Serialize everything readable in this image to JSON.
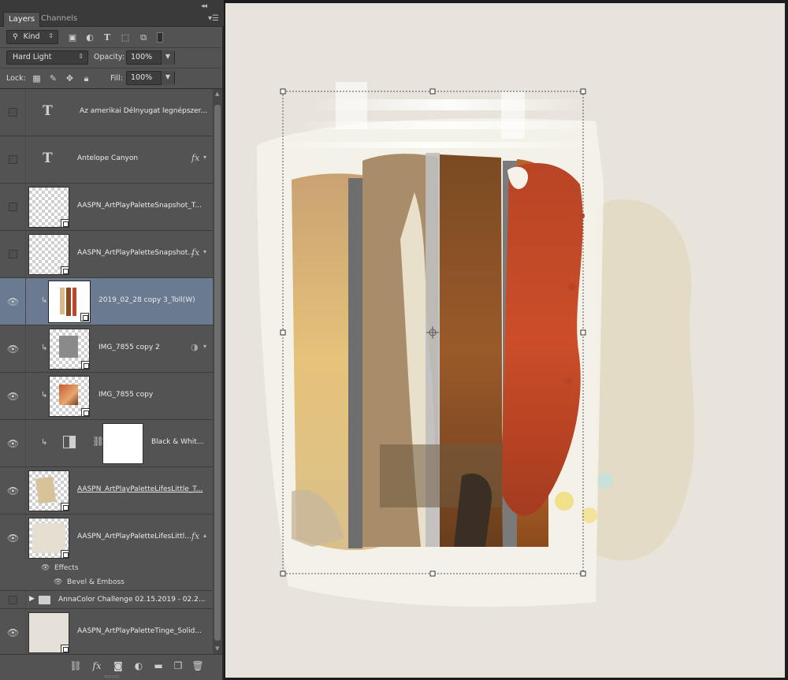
{
  "panel": {
    "collapse_glyph": "◂◂",
    "close_glyph": "✕",
    "menu_glyph": "▾☰",
    "tabs": [
      {
        "label": "Layers"
      },
      {
        "label": "Channels"
      }
    ],
    "filter": {
      "kind_label": "Kind"
    },
    "blend": {
      "mode": "Hard Light",
      "opacity_label": "Opacity:",
      "opacity_value": "100%"
    },
    "lock": {
      "label": "Lock:",
      "fill_label": "Fill:",
      "fill_value": "100%"
    }
  },
  "layers": [
    {
      "name": "Az amerikai Délnyugat legnépszer...",
      "type": "text",
      "visible": false
    },
    {
      "name": "Antelope Canyon",
      "type": "text",
      "visible": false,
      "fx": "fx"
    },
    {
      "name": "AASPN_ArtPlayPaletteSnapshot_T...",
      "type": "image",
      "visible": false
    },
    {
      "name": "AASPN_ArtPlayPaletteSnapshot...",
      "type": "image",
      "visible": false,
      "fx": "fx"
    },
    {
      "name": "2019_02_28 copy 3_Toll(W)",
      "type": "image",
      "visible": true,
      "clipped": true,
      "selected": true
    },
    {
      "name": "IMG_7855 copy 2",
      "type": "image",
      "visible": true,
      "clipped": true
    },
    {
      "name": "IMG_7855 copy",
      "type": "image",
      "visible": true,
      "clipped": true
    },
    {
      "name": "Black & Whit...",
      "type": "adjustment",
      "visible": true,
      "clipped": true
    },
    {
      "name": "AASPN_ArtPlayPaletteLifesLittle_T...",
      "type": "image",
      "visible": true
    },
    {
      "name": "AASPN_ArtPlayPaletteLifesLittl...",
      "type": "image",
      "visible": true,
      "fx": "fx"
    }
  ],
  "effects": {
    "label": "Effects",
    "items": [
      "Bevel & Emboss"
    ]
  },
  "group": {
    "name": "AnnaColor Challenge 02.15.2019 - 02.2...",
    "visible": false
  },
  "last_layer": {
    "name": "AASPN_ArtPlayPaletteTinge_Solid...",
    "visible": true
  },
  "bottom_icons": [
    "link-icon",
    "fx-icon",
    "mask-icon",
    "adjustment-icon",
    "folder-icon",
    "new-layer-icon",
    "trash-icon"
  ],
  "colors": {
    "panel": "#535353",
    "selected": "#6a7a90",
    "paper": "#e9e4db",
    "accent_red": "#c0452a",
    "accent_brown": "#8a4a1e"
  }
}
